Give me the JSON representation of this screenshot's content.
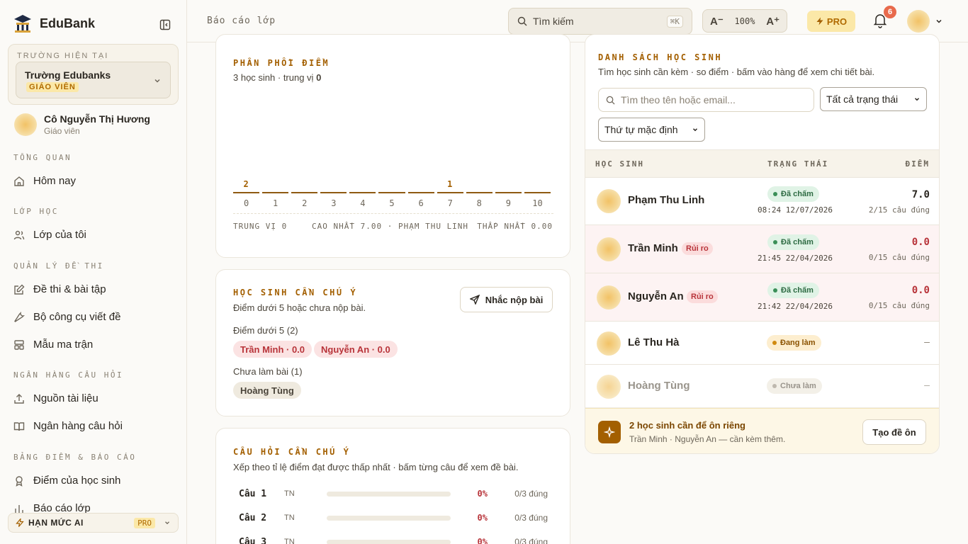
{
  "sidebar": {
    "brand": "EduBank",
    "school_caption": "TRƯỜNG HIỆN TẠI",
    "school_name": "Trường Edubanks",
    "school_role": "GIÁO VIÊN",
    "user_name": "Cô Nguyễn Thị Hương",
    "user_role": "Giáo viên",
    "sections": [
      {
        "title": "TỔNG QUAN",
        "items": [
          {
            "label": "Hôm nay",
            "icon": "home-icon"
          }
        ]
      },
      {
        "title": "LỚP HỌC",
        "items": [
          {
            "label": "Lớp của tôi",
            "icon": "users-icon"
          }
        ]
      },
      {
        "title": "QUẢN LÝ ĐỀ THI",
        "items": [
          {
            "label": "Đề thi & bài tập",
            "icon": "edit-icon"
          },
          {
            "label": "Bộ công cụ viết đề",
            "icon": "wrench-icon"
          },
          {
            "label": "Mẫu ma trận",
            "icon": "grid-icon"
          }
        ]
      },
      {
        "title": "NGÂN HÀNG CÂU HỎI",
        "items": [
          {
            "label": "Nguồn tài liệu",
            "icon": "upload-icon"
          },
          {
            "label": "Ngân hàng câu hỏi",
            "icon": "book-icon"
          }
        ]
      },
      {
        "title": "BẢNG ĐIỂM & BÁO CÁO",
        "items": [
          {
            "label": "Điểm của học sinh",
            "icon": "award-icon"
          },
          {
            "label": "Báo cáo lớp",
            "icon": "chart-icon"
          }
        ]
      }
    ],
    "ai_quota_label": "HẠN MỨC AI",
    "ai_quota_tag": "PRO"
  },
  "topbar": {
    "breadcrumb": "Báo cáo lớp",
    "search_placeholder": "Tìm kiếm",
    "search_shortcut": "⌘K",
    "zoom_minus": "A⁻",
    "zoom_value": "100%",
    "zoom_plus": "A⁺",
    "pro_label": "PRO",
    "notification_count": "6"
  },
  "distribution": {
    "caption": "PHÂN PHỐI ĐIỂM",
    "subtitle_prefix": "3 học sinh · trung vị ",
    "subtitle_value": "0",
    "stat_median": "TRUNG VỊ 0",
    "stat_max": "CAO NHẤT 7.00 · PHẠM THU LINH",
    "stat_min": "THẤP NHẤT 0.00"
  },
  "chart_data": {
    "type": "bar",
    "categories": [
      "0",
      "1",
      "2",
      "3",
      "4",
      "5",
      "6",
      "7",
      "8",
      "9",
      "10"
    ],
    "values": [
      2,
      0,
      0,
      0,
      0,
      0,
      0,
      1,
      0,
      0,
      0
    ]
  },
  "attention_students": {
    "caption": "HỌC SINH CẦN CHÚ Ý",
    "subtitle": "Điểm dưới 5 hoặc chưa nộp bài.",
    "remind_button": "Nhắc nộp bài",
    "below5_title": "Điểm dưới 5 (2)",
    "below5": [
      "Trần Minh · 0.0",
      "Nguyễn An · 0.0"
    ],
    "not_started_title": "Chưa làm bài (1)",
    "not_started": [
      "Hoàng Tùng"
    ]
  },
  "attention_questions": {
    "caption": "CÂU HỎI CẦN CHÚ Ý",
    "subtitle": "Xếp theo tỉ lệ điểm đạt được thấp nhất · bấm từng câu để xem đề bài.",
    "rows": [
      {
        "label": "Câu 1",
        "type": "TN",
        "pct": "0%",
        "ratio": 0,
        "correct": "0/3 đúng"
      },
      {
        "label": "Câu 2",
        "type": "TN",
        "pct": "0%",
        "ratio": 0,
        "correct": "0/3 đúng"
      },
      {
        "label": "Câu 3",
        "type": "TN",
        "pct": "0%",
        "ratio": 0,
        "correct": "0/3 đúng"
      }
    ]
  },
  "students": {
    "caption": "DANH SÁCH HỌC SINH",
    "subtitle": "Tìm học sinh cần kèm · so điểm · bấm vào hàng để xem chi tiết bài.",
    "search_placeholder": "Tìm theo tên hoặc email...",
    "status_filter": "Tất cả trạng thái",
    "sort_filter": "Thứ tự mặc định",
    "col_student": "HỌC SINH",
    "col_status": "TRẠNG THÁI",
    "col_score": "ĐIỂM",
    "rows": [
      {
        "name": "Phạm Thu Linh",
        "risk": "",
        "status": "Đã chấm",
        "time": "08:24 12/07/2026",
        "score": "7.0",
        "correct": "2/15 câu đúng"
      },
      {
        "name": "Trần Minh",
        "risk": "Rủi ro",
        "status": "Đã chấm",
        "time": "21:45 22/04/2026",
        "score": "0.0",
        "correct": "0/15 câu đúng"
      },
      {
        "name": "Nguyễn An",
        "risk": "Rủi ro",
        "status": "Đã chấm",
        "time": "21:42 22/04/2026",
        "score": "0.0",
        "correct": "0/15 câu đúng"
      },
      {
        "name": "Lê Thu Hà",
        "risk": "",
        "status": "Đang làm",
        "time": "",
        "score": "—",
        "correct": ""
      },
      {
        "name": "Hoàng Tùng",
        "risk": "",
        "status": "Chưa làm",
        "time": "",
        "score": "—",
        "correct": ""
      }
    ],
    "footer_title": "2 học sinh cần để ôn riêng",
    "footer_sub": "Trần Minh · Nguyễn An — cần kèm thêm.",
    "footer_button": "Tạo đề ôn"
  },
  "colors": {
    "accent": "#a35f00",
    "risk": "#b8343a",
    "done": "#3a8f57"
  }
}
